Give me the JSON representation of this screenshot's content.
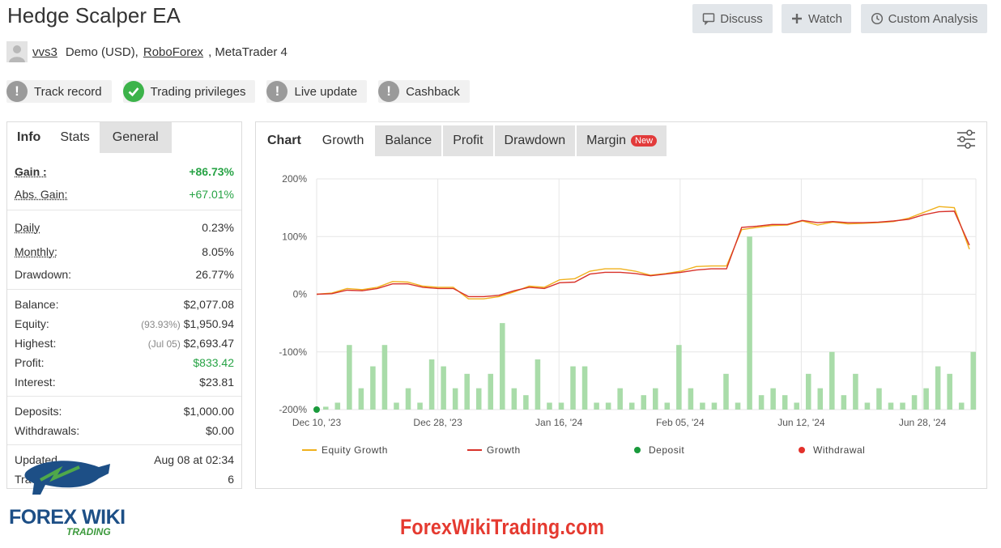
{
  "header": {
    "title": "Hedge Scalper EA",
    "buttons": {
      "discuss": "Discuss",
      "watch": "Watch",
      "custom_analysis": "Custom Analysis"
    }
  },
  "account": {
    "user": "vvs3",
    "type": "Demo (USD),",
    "broker": "RoboForex",
    "platform": ", MetaTrader 4"
  },
  "badges": [
    {
      "label": "Track record",
      "status": "grey"
    },
    {
      "label": "Trading privileges",
      "status": "green"
    },
    {
      "label": "Live update",
      "status": "grey"
    },
    {
      "label": "Cashback",
      "status": "grey"
    }
  ],
  "stats_panel": {
    "tabs": [
      "Info",
      "Stats",
      "General"
    ],
    "gain_label": "Gain :",
    "gain_value": "+86.73%",
    "abs_gain_label": "Abs. Gain:",
    "abs_gain_value": "+67.01%",
    "daily_label": "Daily",
    "daily_value": "0.23%",
    "monthly_label": "Monthly:",
    "monthly_value": "8.05%",
    "drawdown_label": "Drawdown:",
    "drawdown_value": "26.77%",
    "balance_label": "Balance:",
    "balance_value": "$2,077.08",
    "equity_label": "Equity:",
    "equity_pct": "(93.93%)",
    "equity_value": "$1,950.94",
    "highest_label": "Highest:",
    "highest_date": "(Jul 05)",
    "highest_value": "$2,693.47",
    "profit_label": "Profit:",
    "profit_value": "$833.42",
    "interest_label": "Interest:",
    "interest_value": "$23.81",
    "deposits_label": "Deposits:",
    "deposits_value": "$1,000.00",
    "withdrawals_label": "Withdrawals:",
    "withdrawals_value": "$0.00",
    "updated_label": "Updated",
    "updated_value": "Aug 08 at 02:34",
    "tracking_label": "Tracking:",
    "tracking_value": "6"
  },
  "chart_panel": {
    "tabs": [
      "Chart",
      "Growth",
      "Balance",
      "Profit",
      "Drawdown",
      "Margin"
    ],
    "new_badge": "New",
    "legend": [
      "Equity Growth",
      "Growth",
      "Deposit",
      "Withdrawal"
    ]
  },
  "watermark": {
    "site": "ForexWikiTrading.com",
    "logo_main": "FOREX WIKI",
    "logo_sub": "TRADING"
  },
  "colors": {
    "equity": "#f0b11c",
    "growth": "#d8322a",
    "deposit": "#1a9a3c",
    "withdrawal": "#e3312b",
    "bars": "#a9dca9",
    "gain_green": "#27a345"
  },
  "chart_data": {
    "type": "line",
    "x_ticks": [
      "Dec 10, '23",
      "Dec 28, '23",
      "Jan 16, '24",
      "Feb 05, '24",
      "Jun 12, '24",
      "Jun 28, '24"
    ],
    "y_ticks": [
      "200%",
      "100%",
      "0%",
      "-100%",
      "-200%"
    ],
    "ylim": [
      -200,
      200
    ],
    "series": [
      {
        "name": "Equity Growth",
        "values": [
          0,
          2,
          10,
          8,
          12,
          22,
          21,
          14,
          12,
          12,
          -8,
          -8,
          -4,
          4,
          14,
          12,
          25,
          27,
          40,
          44,
          44,
          40,
          33,
          36,
          40,
          48,
          49,
          49,
          112,
          116,
          119,
          120,
          127,
          120,
          125,
          122,
          123,
          124,
          126,
          132,
          142,
          152,
          150,
          78
        ]
      },
      {
        "name": "Growth",
        "values": [
          0,
          1,
          7,
          6,
          10,
          18,
          18,
          12,
          10,
          10,
          -4,
          -4,
          -2,
          6,
          12,
          10,
          20,
          21,
          35,
          38,
          38,
          36,
          32,
          35,
          38,
          42,
          44,
          44,
          116,
          118,
          121,
          121,
          128,
          124,
          126,
          124,
          124,
          125,
          127,
          130,
          138,
          143,
          144,
          85
        ]
      },
      {
        "name": "Growth bars",
        "values": [
          -195,
          -188,
          -88,
          -163,
          -125,
          -88,
          -188,
          -163,
          -188,
          -113,
          -125,
          -163,
          -138,
          -163,
          -138,
          -50,
          -163,
          -175,
          -113,
          -188,
          -188,
          -125,
          -125,
          -188,
          -188,
          -163,
          -188,
          -175,
          -163,
          -188,
          -88,
          -163,
          -188,
          -188,
          -138,
          -188,
          100,
          -175,
          -163,
          -175,
          -188,
          -138,
          -163,
          -100,
          -175,
          -138,
          -188,
          -163,
          -188,
          -188,
          -175,
          -163,
          -125,
          -138,
          -188,
          -100
        ]
      }
    ]
  }
}
